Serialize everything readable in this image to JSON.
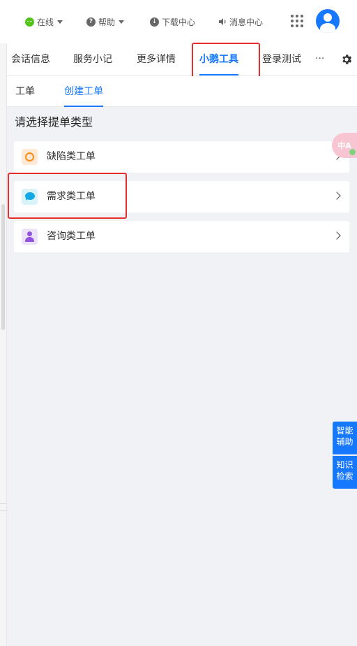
{
  "topbar": {
    "status_label": "在线",
    "help_label": "帮助",
    "download_label": "下载中心",
    "messages_label": "消息中心"
  },
  "tabs": [
    {
      "label": "会话信息"
    },
    {
      "label": "服务小记"
    },
    {
      "label": "更多详情"
    },
    {
      "label": "小鹅工具"
    },
    {
      "label": "登录测试"
    }
  ],
  "more_label": "···",
  "subtabs": [
    {
      "label": "工单"
    },
    {
      "label": "创建工单"
    }
  ],
  "prompt": "请选择提单类型",
  "ticket_types": [
    {
      "label": "缺陷类工单",
      "icon": "circle-icon"
    },
    {
      "label": "需求类工单",
      "icon": "chat-bubble-icon"
    },
    {
      "label": "咨询类工单",
      "icon": "person-icon"
    }
  ],
  "widgets": {
    "translate_label": "中A",
    "assist_label": "智能辅助",
    "knowledge_label": "知识检索"
  },
  "colors": {
    "accent": "#1677ff",
    "highlight": "#e62e2e"
  }
}
